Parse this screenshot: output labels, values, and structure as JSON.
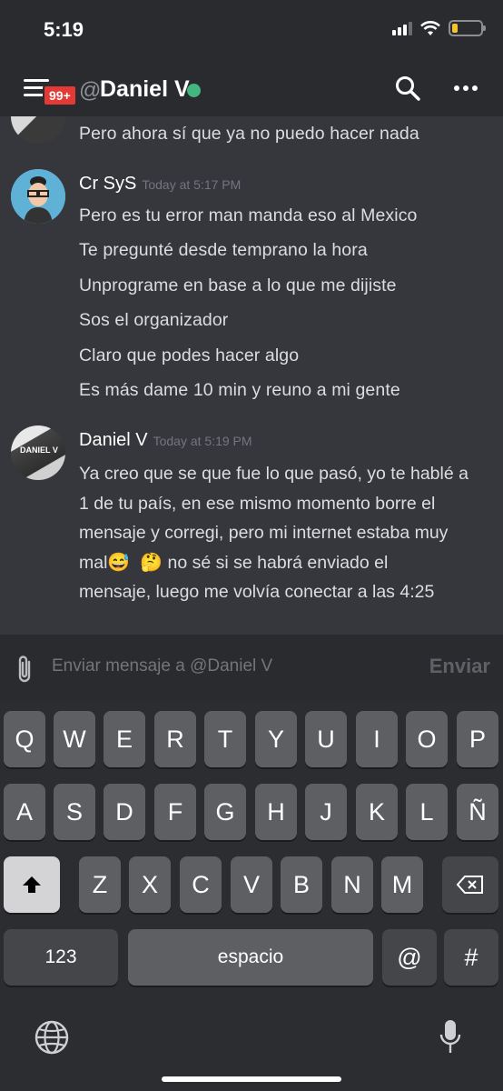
{
  "status_bar": {
    "time": "5:19"
  },
  "header": {
    "badge": "99+",
    "at": "@",
    "channel_name": "Daniel V"
  },
  "messages": {
    "previous_line": "Pero ahora sí que ya no puedo hacer nada",
    "groups": [
      {
        "author": "Cr SyS",
        "timestamp": "Today at 5:17 PM",
        "lines": [
          "Pero es tu error man manda eso al Mexico",
          "Te pregunté desde temprano la hora",
          "Unprograme en base a lo que me dijiste",
          "Sos el organizador",
          "Claro que podes hacer algo",
          "Es más dame 10 min y reuno a mi gente"
        ]
      },
      {
        "author": "Daniel V",
        "avatar_text": "DANIEL V",
        "timestamp": "Today at 5:19 PM",
        "line1": "Ya creo que se que fue lo que pasó, yo te hablé a",
        "line2": "1 de tu país, en ese mismo momento borre el",
        "line3": "mensaje y corregi, pero mi internet estaba muy",
        "line4_start": "mal",
        "emoji1": "😅",
        "emoji2": "🤔",
        "line4_end": " no sé si se habrá enviado el",
        "line5": "mensaje, luego me volvía conectar a las 4:25"
      }
    ]
  },
  "composer": {
    "placeholder": "Enviar mensaje a @Daniel V",
    "send_label": "Enviar"
  },
  "keyboard": {
    "row1": [
      "Q",
      "W",
      "E",
      "R",
      "T",
      "Y",
      "U",
      "I",
      "O",
      "P"
    ],
    "row2": [
      "A",
      "S",
      "D",
      "F",
      "G",
      "H",
      "J",
      "K",
      "L",
      "Ñ"
    ],
    "row3": [
      "Z",
      "X",
      "C",
      "V",
      "B",
      "N",
      "M"
    ],
    "numbers_label": "123",
    "space_label": "espacio",
    "at_label": "@",
    "hash_label": "#"
  },
  "colors": {
    "online": "#43b581",
    "badge": "#e53935",
    "background": "#36373c"
  }
}
